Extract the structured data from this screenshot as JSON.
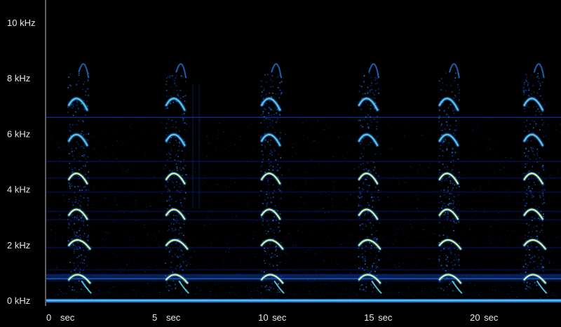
{
  "chart_data": {
    "type": "heatmap",
    "title": "",
    "xlabel": "",
    "ylabel": "",
    "x_unit": "sec",
    "y_unit": "kHz",
    "xlim": [
      0,
      24.3
    ],
    "ylim": [
      0,
      10.6
    ],
    "x_ticks": [
      {
        "value": 0,
        "number": "0",
        "unit": "sec"
      },
      {
        "value": 5,
        "number": "5",
        "unit": "sec"
      },
      {
        "value": 10,
        "number": "10",
        "unit": "sec"
      },
      {
        "value": 15,
        "number": "15",
        "unit": "sec"
      },
      {
        "value": 20,
        "number": "20",
        "unit": "sec"
      }
    ],
    "y_ticks": [
      {
        "value": 0,
        "label": "0 kHz"
      },
      {
        "value": 2,
        "label": "2 kHz"
      },
      {
        "value": 4,
        "label": "4 kHz"
      },
      {
        "value": 6,
        "label": "6 kHz"
      },
      {
        "value": 8,
        "label": "8 kHz"
      },
      {
        "value": 10,
        "label": "10 kHz"
      }
    ],
    "colormap": [
      "#000000",
      "#06104a",
      "#0a3aa8",
      "#1f7be0",
      "#5fd0f0",
      "#e6ff9a"
    ],
    "call_onsets_sec": [
      1.2,
      5.8,
      10.3,
      14.9,
      18.7,
      22.7
    ],
    "harmonic_bands_khz": [
      0.95,
      2.2,
      3.3,
      4.6,
      6.0,
      7.3
    ],
    "constant_tone_khz": 6.6,
    "background_noise_bands_khz": [
      0.7,
      0.9,
      1.1,
      1.9,
      2.9,
      3.2,
      3.9,
      4.4,
      5.0
    ]
  }
}
